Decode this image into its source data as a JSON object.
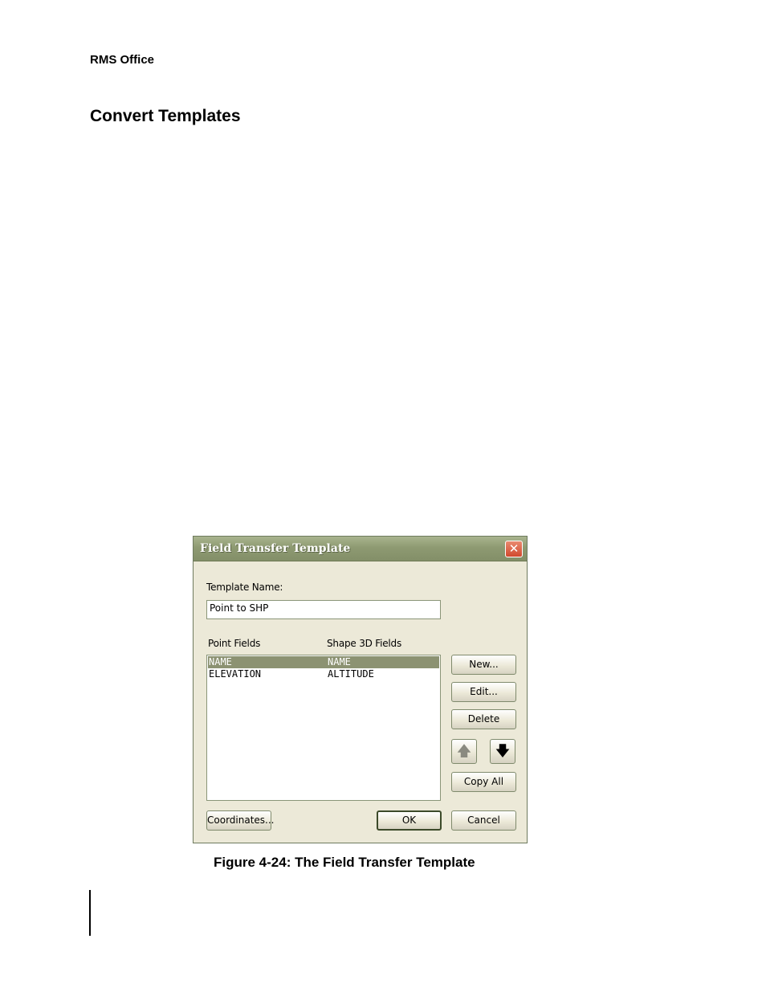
{
  "page": {
    "running_head": "RMS Office",
    "section_title": "Convert Templates",
    "figure_caption": "Figure 4-24: The Field Transfer Template"
  },
  "dialog": {
    "title": "Field Transfer Template",
    "close_glyph": "✕",
    "template_name_label": "Template Name:",
    "template_name_value": "Point to SHP",
    "col_point_fields": "Point Fields",
    "col_shape_fields": "Shape 3D Fields",
    "rows": [
      {
        "point": "NAME",
        "shape": "NAME",
        "selected": true
      },
      {
        "point": "ELEVATION",
        "shape": "ALTITUDE",
        "selected": false
      }
    ],
    "buttons": {
      "new": "New...",
      "edit": "Edit...",
      "delete": "Delete",
      "up_glyph": "🡅",
      "down_glyph": "🡇",
      "copy_all": "Copy All",
      "coordinates": "Coordinates...",
      "ok": "OK",
      "cancel": "Cancel"
    },
    "icons": {
      "up": "arrow-up-icon",
      "down": "arrow-down-icon",
      "close": "close-icon"
    },
    "colors": {
      "titlebar": "#8e9a72",
      "selection": "#8c9272",
      "close": "#d1492e"
    }
  }
}
